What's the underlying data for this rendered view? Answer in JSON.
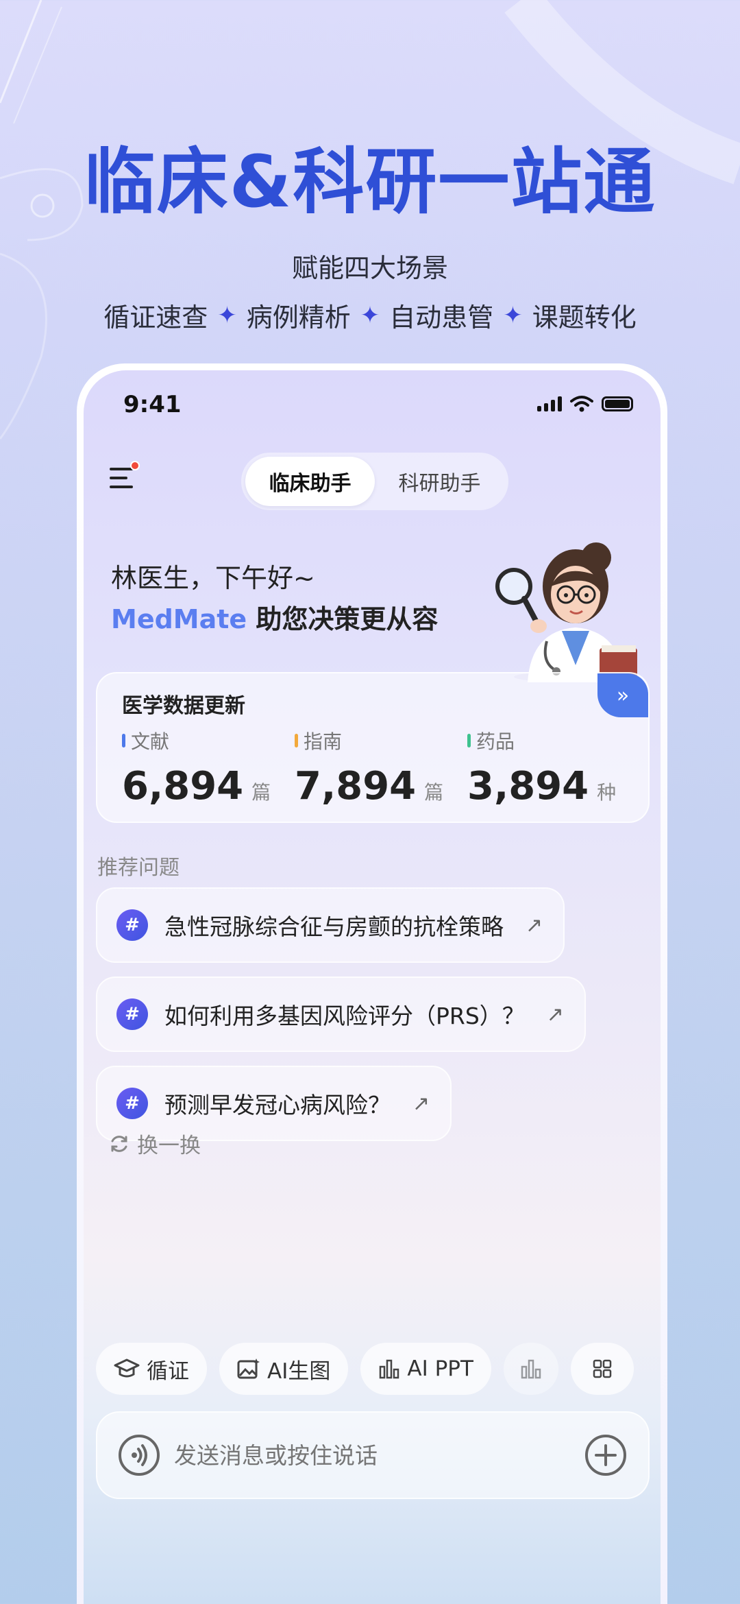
{
  "promo": {
    "headline": "临床&科研一站通",
    "subtitle": "赋能四大场景",
    "scenes": [
      "循证速查",
      "病例精析",
      "自动患管",
      "课题转化"
    ],
    "accent": "#2f4fd6"
  },
  "status_bar": {
    "time": "9:41"
  },
  "header": {
    "tabs": [
      {
        "label": "临床助手",
        "active": true
      },
      {
        "label": "科研助手",
        "active": false
      }
    ]
  },
  "greeting": {
    "line1": "林医生，下午好~",
    "brand": "MedMate",
    "line2_rest": " 助您决策更从容"
  },
  "stats": {
    "title": "医学数据更新",
    "items": [
      {
        "label": "文献",
        "value": "6,894",
        "unit": "篇",
        "color": "#4d79ea"
      },
      {
        "label": "指南",
        "value": "7,894",
        "unit": "篇",
        "color": "#f2a93b"
      },
      {
        "label": "药品",
        "value": "3,894",
        "unit": "种",
        "color": "#3ec28f"
      }
    ]
  },
  "recommend": {
    "title": "推荐问题",
    "questions": [
      "急性冠脉综合征与房颤的抗栓策略",
      "如何利用多基因风险评分（PRS）？",
      "预测早发冠心病风险？"
    ],
    "refresh_label": "换一换"
  },
  "tools": {
    "evidence": "循证",
    "ai_image": "AI生图",
    "ai_ppt": "AI PPT"
  },
  "composer": {
    "placeholder": "发送消息或按住说话"
  }
}
